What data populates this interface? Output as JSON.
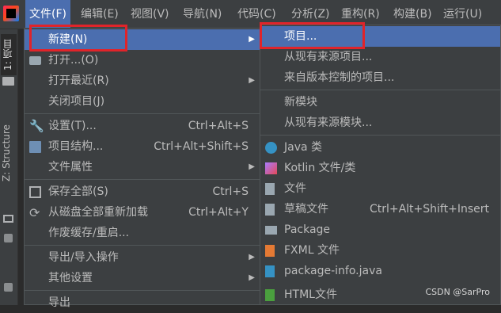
{
  "menubar": {
    "items": [
      "文件(F)",
      "编辑(E)",
      "视图(V)",
      "导航(N)",
      "代码(C)",
      "分析(Z)",
      "重构(R)",
      "构建(B)",
      "运行(U)"
    ]
  },
  "sidebar": {
    "tab_project": "1: 项目",
    "tab_structure": "Z: Structure"
  },
  "file_menu": {
    "new": "新建(N)",
    "open": "打开...(O)",
    "open_recent": "打开最近(R)",
    "close_project": "关闭项目(J)",
    "settings": "设置(T)...",
    "settings_shortcut": "Ctrl+Alt+S",
    "project_structure": "项目结构...",
    "project_structure_shortcut": "Ctrl+Alt+Shift+S",
    "file_properties": "文件属性",
    "save_all": "保存全部(S)",
    "save_all_shortcut": "Ctrl+S",
    "reload_all": "从磁盘全部重新加载",
    "reload_all_shortcut": "Ctrl+Alt+Y",
    "invalidate_caches": "作废缓存/重启...",
    "import_export": "导出/导入操作",
    "other_settings": "其他设置",
    "export": "导出"
  },
  "new_submenu": {
    "project": "项目...",
    "project_from_existing": "从现有来源项目...",
    "project_from_vcs": "来自版本控制的项目...",
    "module": "新模块",
    "module_from_existing": "从现有来源模块...",
    "java_class": "Java 类",
    "kotlin_file": "Kotlin 文件/类",
    "file": "文件",
    "scratch_file": "草稿文件",
    "scratch_file_shortcut": "Ctrl+Alt+Shift+Insert",
    "package": "Package",
    "fxml_file": "FXML 文件",
    "package_info": "package-info.java",
    "html_file": "HTML文件"
  },
  "watermark": "CSDN @SarPro",
  "colors": {
    "highlight": "#4b6eaf",
    "annotation_red": "#e0242a",
    "menu_bg": "#3c3f41"
  }
}
